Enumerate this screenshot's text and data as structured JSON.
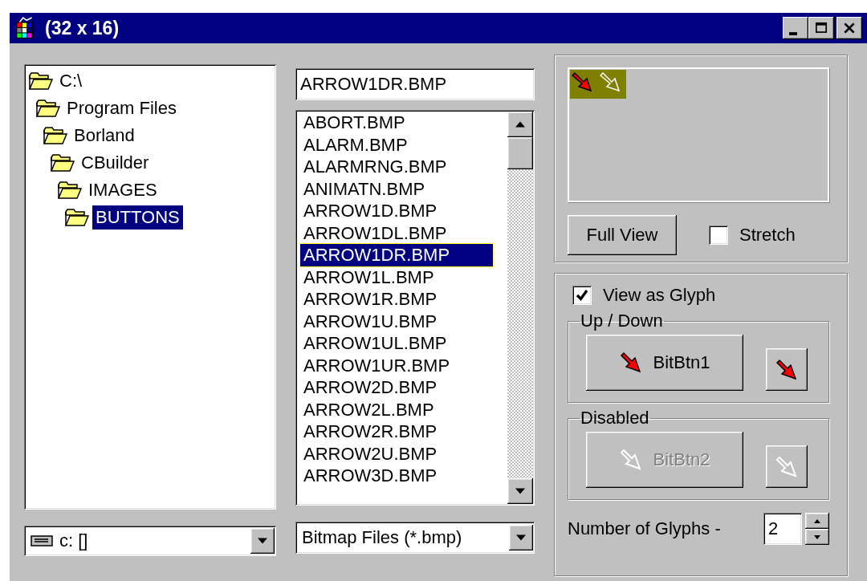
{
  "window": {
    "title": "(32 x 16)"
  },
  "folders": [
    {
      "name": "C:\\",
      "selected": false,
      "children": [
        {
          "name": "Program Files",
          "selected": false,
          "children": [
            {
              "name": "Borland",
              "selected": false,
              "children": [
                {
                  "name": "CBuilder",
                  "selected": false,
                  "children": [
                    {
                      "name": "IMAGES",
                      "selected": false,
                      "children": [
                        {
                          "name": "BUTTONS",
                          "selected": true
                        }
                      ]
                    }
                  ]
                }
              ]
            }
          ]
        }
      ]
    }
  ],
  "drive": {
    "value": "c: []"
  },
  "file_name": {
    "value": "ARROW1DR.BMP"
  },
  "files": [
    {
      "name": "ABORT.BMP",
      "selected": false
    },
    {
      "name": "ALARM.BMP",
      "selected": false
    },
    {
      "name": "ALARMRNG.BMP",
      "selected": false
    },
    {
      "name": "ANIMATN.BMP",
      "selected": false
    },
    {
      "name": "ARROW1D.BMP",
      "selected": false
    },
    {
      "name": "ARROW1DL.BMP",
      "selected": false
    },
    {
      "name": "ARROW1DR.BMP",
      "selected": true
    },
    {
      "name": "ARROW1L.BMP",
      "selected": false
    },
    {
      "name": "ARROW1R.BMP",
      "selected": false
    },
    {
      "name": "ARROW1U.BMP",
      "selected": false
    },
    {
      "name": "ARROW1UL.BMP",
      "selected": false
    },
    {
      "name": "ARROW1UR.BMP",
      "selected": false
    },
    {
      "name": "ARROW2D.BMP",
      "selected": false
    },
    {
      "name": "ARROW2L.BMP",
      "selected": false
    },
    {
      "name": "ARROW2R.BMP",
      "selected": false
    },
    {
      "name": "ARROW2U.BMP",
      "selected": false
    },
    {
      "name": "ARROW3D.BMP",
      "selected": false
    }
  ],
  "filter": {
    "value": "Bitmap Files (*.bmp)"
  },
  "full_view_button": "Full View",
  "stretch": {
    "label": "Stretch",
    "checked": false
  },
  "view_as_glyph": {
    "label": "View as Glyph",
    "checked": true
  },
  "groups": [
    {
      "title": "Up / Down",
      "button": "BitBtn1",
      "disabled": false
    },
    {
      "title": "Disabled",
      "button": "BitBtn2",
      "disabled": true
    }
  ],
  "glyph_count": {
    "label": "Number of Glyphs -",
    "value": "2"
  }
}
